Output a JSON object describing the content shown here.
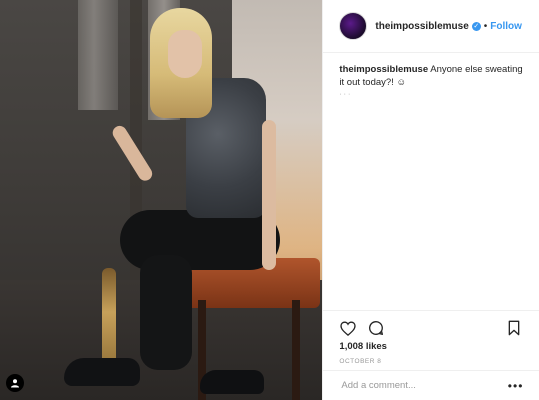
{
  "header": {
    "username": "theimpossiblemuse",
    "separator": "•",
    "follow_label": "Follow"
  },
  "caption": {
    "username": "theimpossiblemuse",
    "text": "Anyone else sweating it out today?! ☺",
    "sub": "· · ·"
  },
  "engagement": {
    "likes": "1,008 likes",
    "date": "OCTOBER 8"
  },
  "comment": {
    "placeholder": "Add a comment..."
  },
  "icons": {
    "verified": "verified-badge-icon",
    "like": "heart-icon",
    "comment": "comment-bubble-icon",
    "save": "bookmark-icon",
    "more": "more-options-icon",
    "tag": "user-tag-icon"
  },
  "colors": {
    "link": "#3897f0",
    "text": "#262626",
    "muted": "#999999"
  }
}
